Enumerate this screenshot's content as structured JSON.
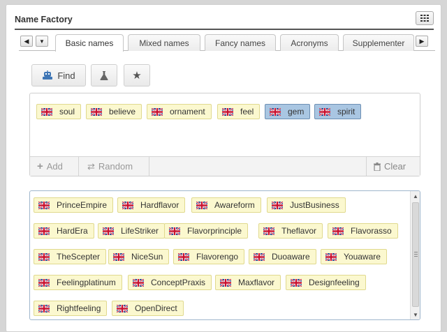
{
  "header": {
    "title": "Name Factory",
    "menu_icon": "grid-icon"
  },
  "tabs": {
    "prev_icon": "triangle-left-icon",
    "dropdown_icon": "triangle-down-icon",
    "next_icon": "triangle-right-icon",
    "items": [
      {
        "label": "Basic names",
        "active": true
      },
      {
        "label": "Mixed names",
        "active": false
      },
      {
        "label": "Fancy names",
        "active": false
      },
      {
        "label": "Acronyms",
        "active": false
      },
      {
        "label": "Supplementer",
        "active": false
      }
    ]
  },
  "toolbar": {
    "find_label": "Find",
    "find_icon": "robot-icon",
    "flask_icon": "flask-icon",
    "star_icon": "star-icon"
  },
  "selected": {
    "chips": [
      {
        "label": "soul",
        "selected": false
      },
      {
        "label": "believe",
        "selected": false
      },
      {
        "label": "ornament",
        "selected": false
      },
      {
        "label": "feel",
        "selected": false
      },
      {
        "label": "gem",
        "selected": true
      },
      {
        "label": "spirit",
        "selected": true
      }
    ],
    "footer": {
      "add_label": "Add",
      "random_label": "Random",
      "clear_label": "Clear"
    }
  },
  "results": {
    "rows": [
      [
        "PrinceEmpire",
        "Hardflavor",
        "Awareform",
        "JustBusiness"
      ],
      [
        "HardEra",
        "LifeStriker",
        "Flavorprinciple",
        "Theflavor",
        "Flavorasso"
      ],
      [
        "TheScepter",
        "NiceSun",
        "Flavorengo",
        "Duoaware",
        "Youaware"
      ],
      [
        "Feelingplatinum",
        "ConceptPraxis",
        "Maxflavor",
        "Designfeeling"
      ],
      [
        "Rightfeeling",
        "OpenDirect"
      ]
    ]
  },
  "colors": {
    "chip_bg": "#fbf8cf",
    "chip_selected_bg": "#a9c6e2",
    "accent_border": "#9fb6cc"
  }
}
